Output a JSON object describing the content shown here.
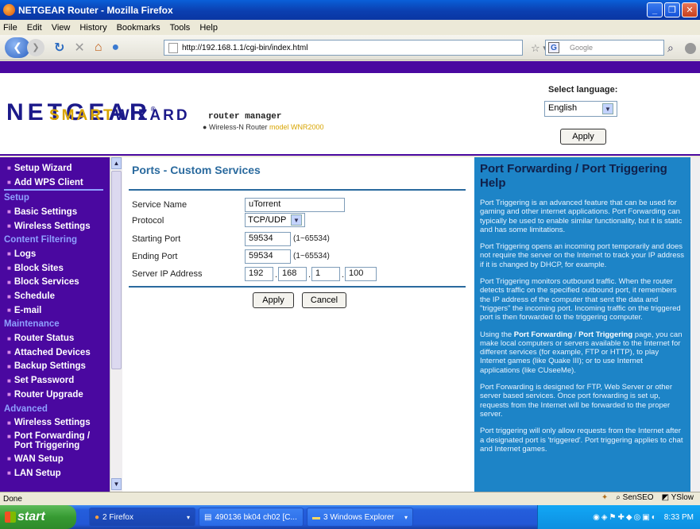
{
  "window": {
    "title": "NETGEAR Router - Mozilla Firefox"
  },
  "menu": [
    "File",
    "Edit",
    "View",
    "History",
    "Bookmarks",
    "Tools",
    "Help"
  ],
  "nav": {
    "url": "http://192.168.1.1/cgi-bin/index.html",
    "search_placeholder": "Google"
  },
  "header": {
    "brand": "NETGEAR",
    "brand_reg": "®",
    "sub_brand_a": "SMART",
    "sub_brand_b": "WIZARD",
    "product_line1": "router manager",
    "product_line2": "Wireless-N Router",
    "model": "model WNR2000",
    "lang_label": "Select language:",
    "lang_value": "English",
    "apply_label": "Apply"
  },
  "sidebar": {
    "setup_wizard": "Setup Wizard",
    "add_wps": "Add WPS Client",
    "sec_setup": "Setup",
    "basic": "Basic Settings",
    "wireless": "Wireless Settings",
    "sec_content": "Content Filtering",
    "logs": "Logs",
    "block_sites": "Block Sites",
    "block_services": "Block Services",
    "schedule": "Schedule",
    "email": "E-mail",
    "sec_maint": "Maintenance",
    "router_status": "Router Status",
    "attached": "Attached Devices",
    "backup": "Backup Settings",
    "password": "Set Password",
    "upgrade": "Router Upgrade",
    "sec_adv": "Advanced",
    "adv_wireless": "Wireless Settings",
    "port_fwd_a": "Port Forwarding /",
    "port_fwd_b": "Port Triggering",
    "wan": "WAN Setup",
    "lan": "LAN Setup"
  },
  "form": {
    "title": "Ports - Custom Services",
    "service_name_label": "Service Name",
    "service_name": "uTorrent",
    "protocol_label": "Protocol",
    "protocol": "TCP/UDP",
    "start_label": "Starting Port",
    "start": "59534",
    "start_range": "(1~65534)",
    "end_label": "Ending Port",
    "end": "59534",
    "end_range": "(1~65534)",
    "ip_label": "Server IP Address",
    "ip1": "192",
    "ip2": "168",
    "ip3": "1",
    "ip4": "100",
    "apply": "Apply",
    "cancel": "Cancel"
  },
  "help": {
    "title": "Port Forwarding / Port Triggering Help",
    "p1": "Port Triggering is an advanced feature that can be used for gaming and other internet applications. Port Forwarding can typically be used to enable similar functionality, but it is static and has some limitations.",
    "p2": "Port Triggering opens an incoming port temporarily and does not require the server on the Internet to track your IP address if it is changed by DHCP, for example.",
    "p3": "Port Triggering monitors outbound traffic. When the router detects traffic on the specified outbound port, it remembers the IP address of the computer that sent the data and \"triggers\" the incoming port. Incoming traffic on the triggered port is then forwarded to the triggering computer.",
    "p4a": "Using the ",
    "p4b": "Port Forwarding",
    "p4c": " / ",
    "p4d": "Port Triggering",
    "p4e": " page, you can make local computers or servers available to the Internet for different services (for example, FTP or HTTP), to play Internet games (like Quake III); or to use Internet applications (like CUseeMe).",
    "p5": "Port Forwarding is designed for FTP, Web Server or other server based services. Once port forwarding is set up, requests from the Internet will be forwarded to the proper server.",
    "p6": "Port triggering will only allow requests from the Internet after a designated port is 'triggered'. Port triggering applies to chat and Internet games."
  },
  "status": {
    "text": "Done",
    "senseo": "SenSEO",
    "yslow": "YSlow"
  },
  "taskbar": {
    "start": "start",
    "t1": "2 Firefox",
    "t2": "490136 bk04 ch02 [C...",
    "t3": "3 Windows Explorer",
    "clock": "8:33 PM"
  }
}
